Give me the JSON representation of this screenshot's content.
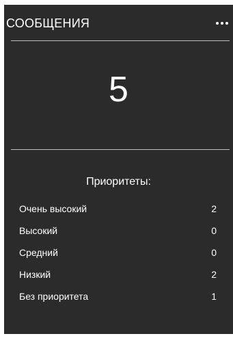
{
  "widget": {
    "title": "СООБЩЕНИЯ",
    "menu_icon": "more-horizontal-icon",
    "total_count": "5"
  },
  "priorities": {
    "heading": "Приоритеты:",
    "rows": [
      {
        "label": "Очень высокий",
        "value": "2"
      },
      {
        "label": "Высокий",
        "value": "0"
      },
      {
        "label": "Средний",
        "value": "0"
      },
      {
        "label": "Низкий",
        "value": "2"
      },
      {
        "label": "Без приоритета",
        "value": "1"
      }
    ]
  },
  "colors": {
    "widget_background": "#2b2b2b",
    "text": "#ffffff",
    "divider": "#bdbdbd"
  }
}
